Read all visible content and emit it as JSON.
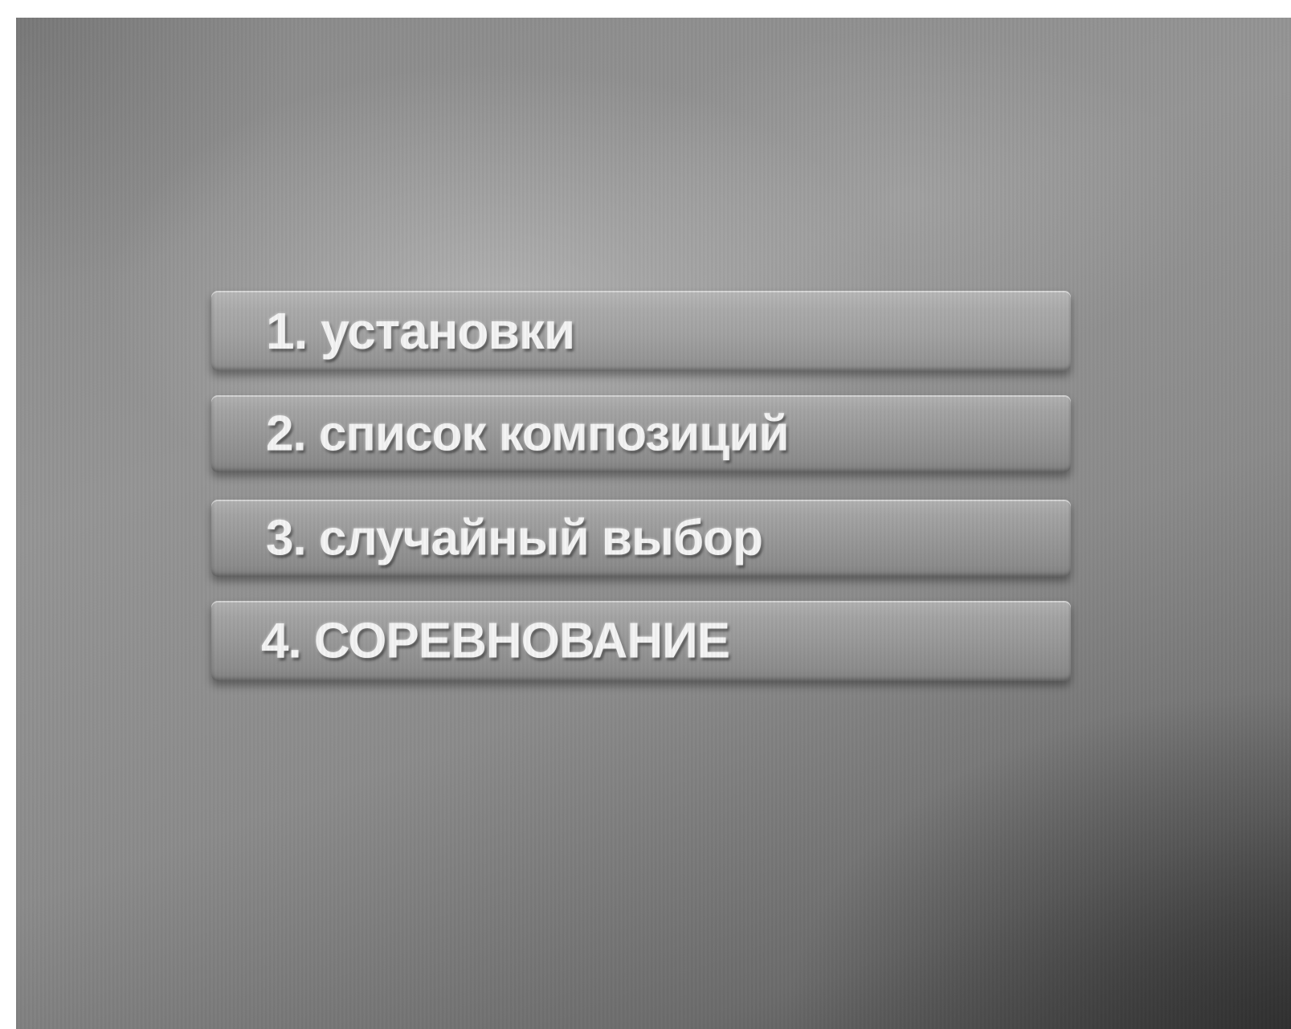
{
  "menu": {
    "items": [
      {
        "label": "1. установки"
      },
      {
        "label": "2. список композиций"
      },
      {
        "label": "3. случайный выбор"
      },
      {
        "label": "4. СОРЕВНОВАНИЕ"
      }
    ],
    "selected_index": 0
  }
}
